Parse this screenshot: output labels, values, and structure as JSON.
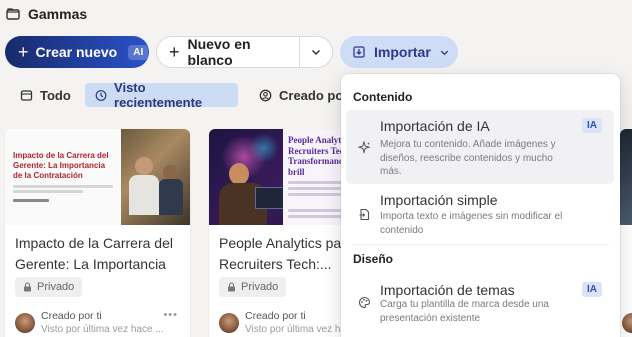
{
  "header": {
    "title": "Gammas",
    "icon": "folder-icon"
  },
  "toolbar": {
    "create_label": "Crear nuevo",
    "create_badge": "AI",
    "blank_label": "Nuevo en blanco",
    "import_label": "Importar"
  },
  "filters": [
    {
      "label": "Todo",
      "icon": "grid-icon"
    },
    {
      "label": "Visto recientemente",
      "icon": "clock-icon",
      "active": true
    },
    {
      "label": "Creado por",
      "icon": "user-icon"
    }
  ],
  "cards": [
    {
      "title": "Impacto de la Carrera del Gerente: La Importancia d...",
      "thumb_heading": "Impacto de la Carrera del Gerente: La Importancia de la Contratación",
      "badge": "Privado",
      "meta_created": "Creado por ti",
      "meta_viewed": "Visto por última vez hace ..."
    },
    {
      "title": "People Analytics par Recruiters Tech:...",
      "thumb_heading": "People Analytics para Recruiters Tech: Transformando decisiones brill",
      "badge": "Privado",
      "meta_created": "Creado por ti",
      "meta_viewed": "Visto por última vez hace ..."
    }
  ],
  "dropdown": {
    "section_content": "Contenido",
    "section_design": "Diseño",
    "items": [
      {
        "name": "Importación de IA",
        "desc": "Mejora tu contenido. Añade imágenes y diseños, reescribe contenidos y mucho más.",
        "badge": "IA",
        "icon": "sparkle-icon"
      },
      {
        "name": "Importación simple",
        "desc": "Importa texto e imágenes sin modificar el contenido",
        "icon": "file-import-icon"
      },
      {
        "name": "Importación de temas",
        "desc": "Carga tu plantilla de marca desde una presentación existente",
        "badge": "IA",
        "icon": "palette-icon"
      }
    ]
  },
  "colors": {
    "primary_gradient_start": "#172a6b",
    "primary_gradient_end": "#2b52c9",
    "import_bg": "#cfdcf6",
    "active_tab_bg": "#cddcf5",
    "ia_badge_bg": "#dbe4f7"
  }
}
